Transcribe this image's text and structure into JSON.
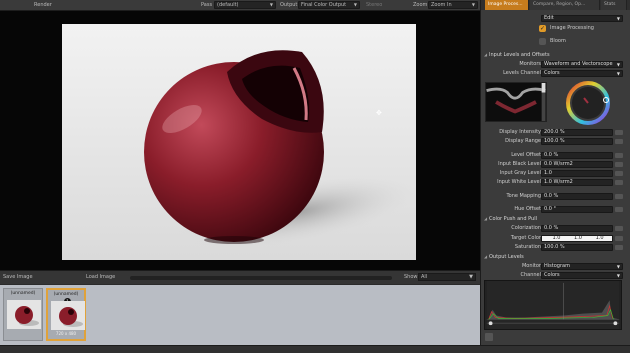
{
  "toolbar": {
    "title": "Render",
    "pass_label": "Pass",
    "pass_value": "(default)",
    "output_label": "Output",
    "output_value": "Final Color Output",
    "stereo_label": "Stereo",
    "zoom_label": "Zoom",
    "zoom_value": "Zoom In"
  },
  "bottom": {
    "save_label": "Save Image",
    "load_label": "Load Image",
    "show_label": "Show",
    "show_value": "All"
  },
  "thumbnails": [
    {
      "label": "(unnamed)",
      "size": ""
    },
    {
      "label": "(unnamed)",
      "size": "720 x 480",
      "badge": "1"
    }
  ],
  "panel": {
    "tabs": [
      "Image Proces...",
      "Compare, Region, Op...",
      "Stats"
    ],
    "effect_value": "Edit",
    "image_processing_label": "Image Processing",
    "bloom_label": "Bloom",
    "sections": {
      "input": "Input Levels and Offsets",
      "color_push": "Color Push and Pull",
      "output": "Output Levels"
    },
    "monitors_label": "Monitors",
    "monitors_value": "Waveform and Vectorscope",
    "levels_channel_label": "Levels Channel",
    "levels_channel_value": "Colors",
    "display_intensity_label": "Display Intensity",
    "display_intensity_value": "200.0 %",
    "display_range_label": "Display Range",
    "display_range_value": "100.0 %",
    "level_offset_label": "Level Offset",
    "level_offset_value": "0.0 %",
    "input_black_label": "Input Black Level",
    "input_black_value": "0.0 W/srm2",
    "input_gray_label": "Input Gray Level",
    "input_gray_value": "1.0",
    "input_white_label": "Input White Level",
    "input_white_value": "1.0 W/srm2",
    "tone_mapping_label": "Tone Mapping",
    "tone_mapping_value": "0.0 %",
    "hue_offset_label": "Hue Offset",
    "hue_offset_value": "0.0 °",
    "colorization_label": "Colorization",
    "colorization_value": "0.0 %",
    "target_color_label": "Target Color",
    "target_color_values": [
      "1.0",
      "1.0",
      "1.0"
    ],
    "saturation_label": "Saturation",
    "saturation_value": "100.0 %",
    "monitor_label": "Monitor",
    "monitor_value": "Histogram",
    "channel_label": "Channel",
    "channel_value": "Colors"
  },
  "colors": {
    "accent": "#c67c1d",
    "sphere": "#8a1d2a"
  }
}
